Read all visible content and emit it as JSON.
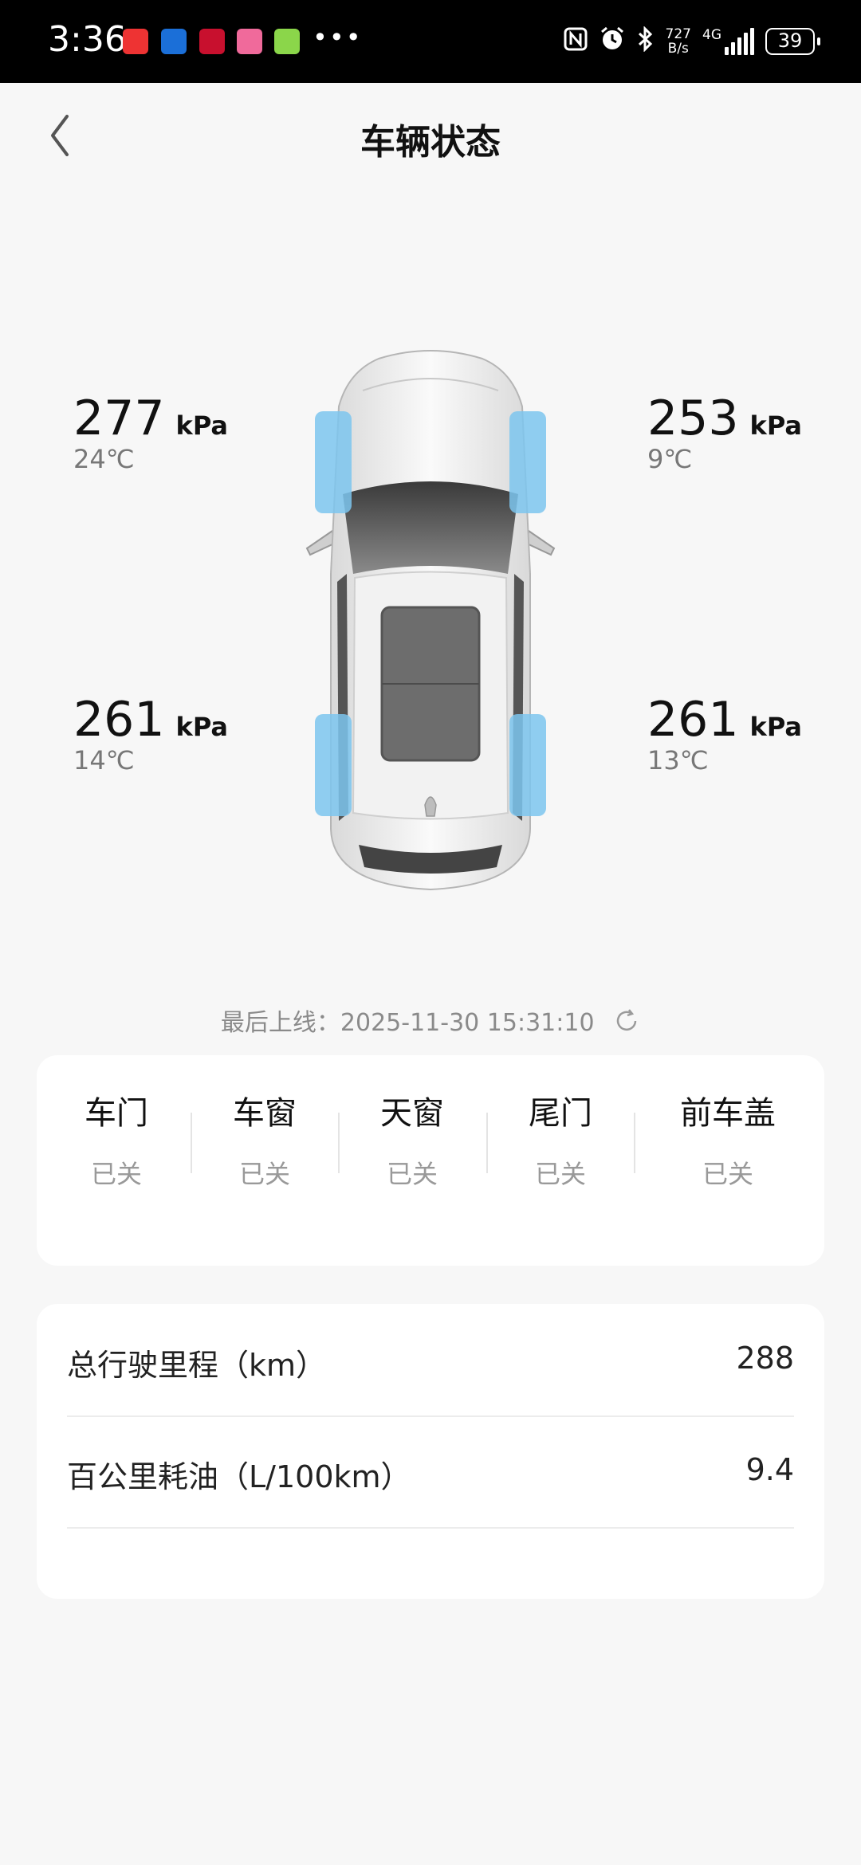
{
  "status_bar": {
    "time": "3:36",
    "net_speed_value": "727",
    "net_speed_unit": "B/s",
    "network": "4G",
    "battery": "39"
  },
  "header": {
    "title": "车辆状态"
  },
  "tires": {
    "front_left": {
      "pressure": "277",
      "unit": "kPa",
      "temp": "24℃"
    },
    "front_right": {
      "pressure": "253",
      "unit": "kPa",
      "temp": "9℃"
    },
    "rear_left": {
      "pressure": "261",
      "unit": "kPa",
      "temp": "14℃"
    },
    "rear_right": {
      "pressure": "261",
      "unit": "kPa",
      "temp": "13℃"
    }
  },
  "last_online": {
    "label": "最后上线：",
    "timestamp": "2025-11-30 15:31:10"
  },
  "status_items": [
    {
      "label": "车门",
      "value": "已关"
    },
    {
      "label": "车窗",
      "value": "已关"
    },
    {
      "label": "天窗",
      "value": "已关"
    },
    {
      "label": "尾门",
      "value": "已关"
    },
    {
      "label": "前车盖",
      "value": "已关"
    }
  ],
  "info": {
    "mileage_label": "总行驶里程（km）",
    "mileage_value": "288",
    "fuel_label": "百公里耗油（L/100km）",
    "fuel_value": "9.4"
  },
  "colors": {
    "tire_highlight": "#7cc6ee",
    "accent": "#111111"
  }
}
